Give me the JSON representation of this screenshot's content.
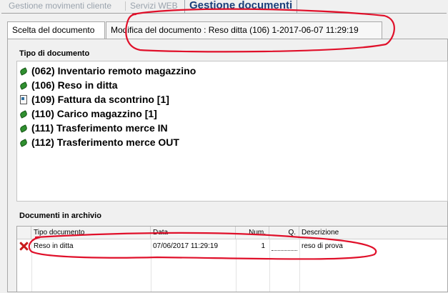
{
  "top_tabs": [
    {
      "label": "Gestione movimenti cliente",
      "active": false
    },
    {
      "label": "Servizi WEB",
      "active": false
    },
    {
      "label": "Gestione documenti",
      "active": true
    }
  ],
  "sub_tabs": [
    {
      "label": "Scelta del documento"
    },
    {
      "label": "Modifica del documento : Reso ditta (106) 1-2017-06-07 11:29:19"
    }
  ],
  "tipo_documento": {
    "group_label": "Tipo di documento",
    "items": [
      {
        "label": "(062) Inventario remoto magazzino",
        "icon": "leaf-icon"
      },
      {
        "label": "(106) Reso in ditta",
        "icon": "leaf-icon"
      },
      {
        "label": "(109) Fattura da scontrino [1]",
        "icon": "document-icon"
      },
      {
        "label": "(110) Carico magazzino [1]",
        "icon": "leaf-icon"
      },
      {
        "label": "(111) Trasferimento merce IN",
        "icon": "leaf-icon"
      },
      {
        "label": "(112) Trasferimento merce OUT",
        "icon": "leaf-icon"
      }
    ]
  },
  "archivio": {
    "group_label": "Documenti in archivio",
    "columns": [
      "Tipo documento",
      "Data",
      "Num.",
      "Q.",
      "Descrizione"
    ],
    "rows": [
      {
        "action_icon": "delete-x-icon",
        "tipo": "Reso in ditta",
        "data": "07/06/2017 11:29:19",
        "num": "1",
        "q": "",
        "descrizione": "reso di prova"
      }
    ]
  },
  "annotation_color": "#e0102a"
}
